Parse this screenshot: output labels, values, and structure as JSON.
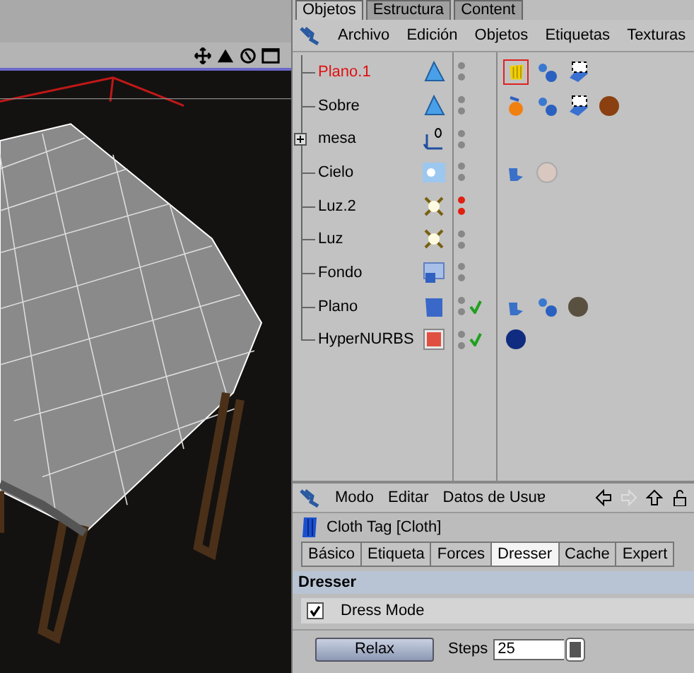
{
  "object_manager": {
    "tabs": [
      {
        "label": "Objetos",
        "selected": true
      },
      {
        "label": "Estructura",
        "selected": false
      },
      {
        "label": "Content",
        "selected": false
      }
    ],
    "menu": [
      "Archivo",
      "Edición",
      "Objetos",
      "Etiquetas",
      "Texturas"
    ],
    "objects": [
      {
        "name": "Plano.1",
        "selected": true,
        "collapsed": false,
        "kind": "polygon",
        "hidden": false,
        "checked": false,
        "tags": [
          {
            "kind": "cloth",
            "selected": true
          },
          {
            "kind": "phong",
            "selected": false
          },
          {
            "kind": "uvw",
            "selected": false
          }
        ]
      },
      {
        "name": "Sobre",
        "selected": false,
        "collapsed": false,
        "kind": "polygon",
        "hidden": false,
        "checked": false,
        "tags": [
          {
            "kind": "collider",
            "selected": false
          },
          {
            "kind": "phong",
            "selected": false
          },
          {
            "kind": "uvw",
            "selected": false
          },
          {
            "kind": "material-brown",
            "selected": false
          }
        ]
      },
      {
        "name": "mesa",
        "selected": false,
        "collapsed": true,
        "kind": "null",
        "hidden": false,
        "checked": false
      },
      {
        "name": "Cielo",
        "selected": false,
        "collapsed": false,
        "kind": "sky",
        "hidden": false,
        "checked": false,
        "tags": [
          {
            "kind": "compositing",
            "selected": false
          },
          {
            "kind": "material-glass",
            "selected": false
          }
        ]
      },
      {
        "name": "Luz.2",
        "selected": false,
        "collapsed": false,
        "kind": "light",
        "hidden": true,
        "checked": false
      },
      {
        "name": "Luz",
        "selected": false,
        "collapsed": false,
        "kind": "light",
        "hidden": false,
        "checked": false
      },
      {
        "name": "Fondo",
        "selected": false,
        "collapsed": false,
        "kind": "background",
        "hidden": false,
        "checked": false
      },
      {
        "name": "Plano",
        "selected": false,
        "collapsed": false,
        "kind": "plane",
        "hidden": false,
        "checked": true,
        "tags": [
          {
            "kind": "compositing",
            "selected": false
          },
          {
            "kind": "phong",
            "selected": false
          },
          {
            "kind": "material-grey",
            "selected": false
          }
        ]
      },
      {
        "name": "HyperNURBS",
        "selected": false,
        "collapsed": false,
        "kind": "hypernurbs",
        "hidden": false,
        "checked": true,
        "tags": [
          {
            "kind": "material-blue",
            "selected": false
          }
        ]
      }
    ]
  },
  "attribute_manager": {
    "menu": [
      "Modo",
      "Editar",
      "Datos de Usuɐ"
    ],
    "title": "Cloth Tag [Cloth]",
    "tabs": [
      {
        "label": "Básico",
        "selected": false
      },
      {
        "label": "Etiqueta",
        "selected": false
      },
      {
        "label": "Forces",
        "selected": false
      },
      {
        "label": "Dresser",
        "selected": true
      },
      {
        "label": "Cache",
        "selected": false
      },
      {
        "label": "Expert",
        "selected": false
      }
    ],
    "section": "Dresser",
    "dress_mode": {
      "label": "Dress Mode",
      "checked": true
    },
    "relax_button": "Relax",
    "steps": {
      "label": "Steps",
      "value": "25"
    }
  }
}
